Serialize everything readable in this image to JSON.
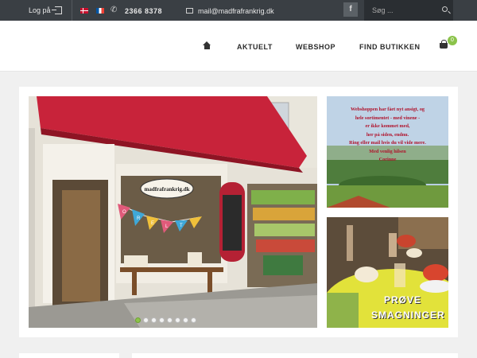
{
  "topbar": {
    "login_label": "Log på",
    "phone": "2366 8378",
    "email": "mail@madfrafrankrig.dk",
    "facebook_label": "f",
    "search_placeholder": "Søg ..."
  },
  "nav": {
    "items": [
      "AKTUELT",
      "WEBSHOP",
      "FIND BUTIKKEN"
    ],
    "cart_count": "0"
  },
  "hero": {
    "sign_text": "madfrafrankrig.dk",
    "bunting_letters": [
      "O",
      "R",
      "E",
      "L",
      "T"
    ],
    "slide_count": 8,
    "active_slide": 1
  },
  "banner_webshop": {
    "lines": [
      "Webshoppen har fået nyt ansigt, og",
      "hele sortimentet - med vinene -",
      "er ikke kommet med,",
      "her på siden, endnu.",
      "Ring eller mail hvis du vil vide mere.",
      "Med venlig hilsen",
      "Corinne"
    ]
  },
  "banner_tasting": {
    "line1": "PRØVE",
    "line2": "SMAGNINGER"
  },
  "colors": {
    "topbar": "#3a3f44",
    "accent_green": "#8bc34a",
    "awning_red": "#c8233a",
    "banner_text_red": "#b0122b"
  }
}
